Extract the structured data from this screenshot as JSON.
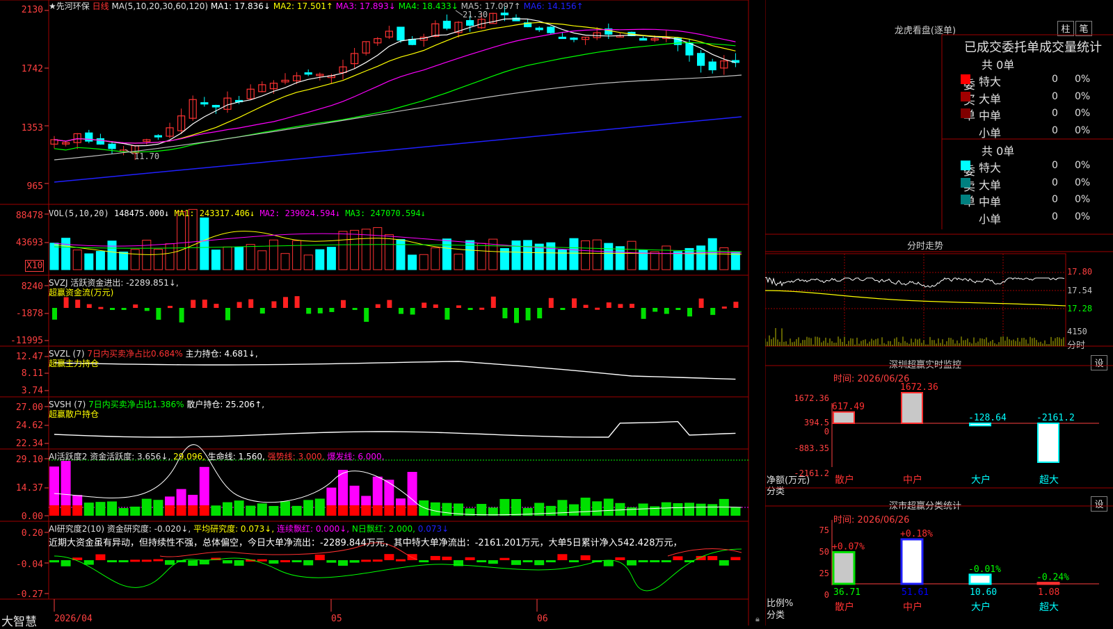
{
  "colors": {
    "up": "#ff3232",
    "down": "#00ffff",
    "bg": "#000000",
    "grid": "#a00000",
    "green": "#00ff00",
    "magenta": "#ff00ff",
    "yellow": "#ffff00",
    "blue": "#0000ff",
    "white": "#ffffff"
  },
  "footer": {
    "brand": "大智慧",
    "date": "2026/04",
    "month1": "05",
    "month2": "06"
  },
  "main": {
    "stock_name": "★先河环保",
    "period": "日线",
    "ma_params": "MA(5,10,20,30,60,120)",
    "ma1": "MA1: 17.836↓",
    "ma2": "MA2: 17.501↑",
    "ma3": "MA3: 17.893↓",
    "ma4": "MA4: 18.433↓",
    "ma5": "MA5: 17.097↑",
    "ma6": "MA6: 14.156↑",
    "high_label": "21.30",
    "low_label": "11.70",
    "yaxis": [
      "2130",
      "1742",
      "1353",
      "965"
    ]
  },
  "vol": {
    "header": "VOL(5,10,20)",
    "value": "148475.000↓",
    "ma1": "MA1: 243317.406↓",
    "ma2": "MA2: 239024.594↓",
    "ma3": "MA3: 247070.594↓",
    "yaxis": [
      "88478",
      "43693"
    ],
    "unit": "X10"
  },
  "svzj": {
    "header": "SVZJ  活跃资金进出: -2289.851↓,",
    "sub": "超赢资金流(万元)",
    "yaxis": [
      "8240",
      "-1878",
      "-11995"
    ]
  },
  "svzl": {
    "header": "SVZL (7)",
    "ratio": "7日内买卖净占比0.684%",
    "hold": "主力持仓: 4.681↓,",
    "sub": "超赢主力持仓",
    "yaxis": [
      "12.47",
      "8.11",
      "3.74"
    ]
  },
  "svsh": {
    "header": "SVSH (7)",
    "ratio": "7日内买卖净占比1.386%",
    "hold": "散户持仓: 25.206↑,",
    "sub": "超赢散户持仓",
    "yaxis": [
      "27.00",
      "24.62",
      "22.34"
    ]
  },
  "ai1": {
    "header": "AI活跃度2 资金活跃度: 3.656↓,",
    "v2": "29.096,",
    "life": "生命线: 1.560,",
    "strong": "强势线: 3.000,",
    "burst": "爆发线: 6.000,",
    "yaxis": [
      "29.10",
      "14.37",
      "0.00"
    ]
  },
  "ai2": {
    "header": "AI研究度2(10) 资金研究度: -0.020↓,",
    "avg": "平均研究度: 0.073↓,",
    "cont": "连续飘红: 0.000↓,",
    "nday": "N日飘红: 2.000,",
    "last": "0.073↓",
    "text": "近期大资金虽有异动，但持续性不强，总体偏空，今日大单净流出：-2289.844万元，其中特大单净流出：-2161.201万元，大单5日累计净入542.428万元，",
    "yaxis": [
      "0.20",
      "-0.04",
      "-0.27"
    ]
  },
  "longhu": {
    "title": "龙虎看盘(逐单)",
    "btn1": "柱",
    "btn2": "笔",
    "tabs": "已成交委托单成交量统计",
    "buy_label": "委买单",
    "sell_label": "委卖单",
    "buy_total": "共 0单",
    "sell_total": "共 0单",
    "rows": [
      {
        "name": "特大",
        "count": "0",
        "pct": "0%"
      },
      {
        "name": "大单",
        "count": "0",
        "pct": "0%"
      },
      {
        "name": "中单",
        "count": "0",
        "pct": "0%"
      },
      {
        "name": "小单",
        "count": "0",
        "pct": "0%"
      }
    ]
  },
  "intraday": {
    "title": "分时走势",
    "yaxis": [
      "17.80",
      "17.54",
      "17.28"
    ],
    "vol": "4150",
    "unit": "分时"
  },
  "sz_monitor": {
    "title": "深圳超赢实时监控",
    "btn": "设",
    "time": "时间: 2026/06/26",
    "yaxis": [
      "1672.36",
      "394.5",
      "0",
      "-883.35",
      "-2161.2"
    ],
    "unit": "净额(万元)",
    "cat": "分类",
    "bars": [
      {
        "name": "散户",
        "label": "617.49",
        "value": 617.49
      },
      {
        "name": "中户",
        "label": "1672.36",
        "value": 1672.36
      },
      {
        "name": "大户",
        "label": "-128.64",
        "value": -128.64
      },
      {
        "name": "超大",
        "label": "-2161.2",
        "value": -2161.2
      }
    ]
  },
  "sz_class": {
    "title": "深市超赢分类统计",
    "btn": "设",
    "time": "时间: 2026/06/26",
    "yaxis": [
      "75",
      "50",
      "25",
      "0"
    ],
    "unit": "比例%",
    "cat": "分类",
    "bars": [
      {
        "name": "散户",
        "label": "+0.07%",
        "value": 36.71,
        "bottom": "36.71"
      },
      {
        "name": "中户",
        "label": "+0.18%",
        "value": 51.61,
        "bottom": "51.61"
      },
      {
        "name": "大户",
        "label": "-0.01%",
        "value": 10.6,
        "bottom": "10.60"
      },
      {
        "name": "超大",
        "label": "-0.24%",
        "value": 1.08,
        "bottom": "1.08"
      }
    ]
  }
}
